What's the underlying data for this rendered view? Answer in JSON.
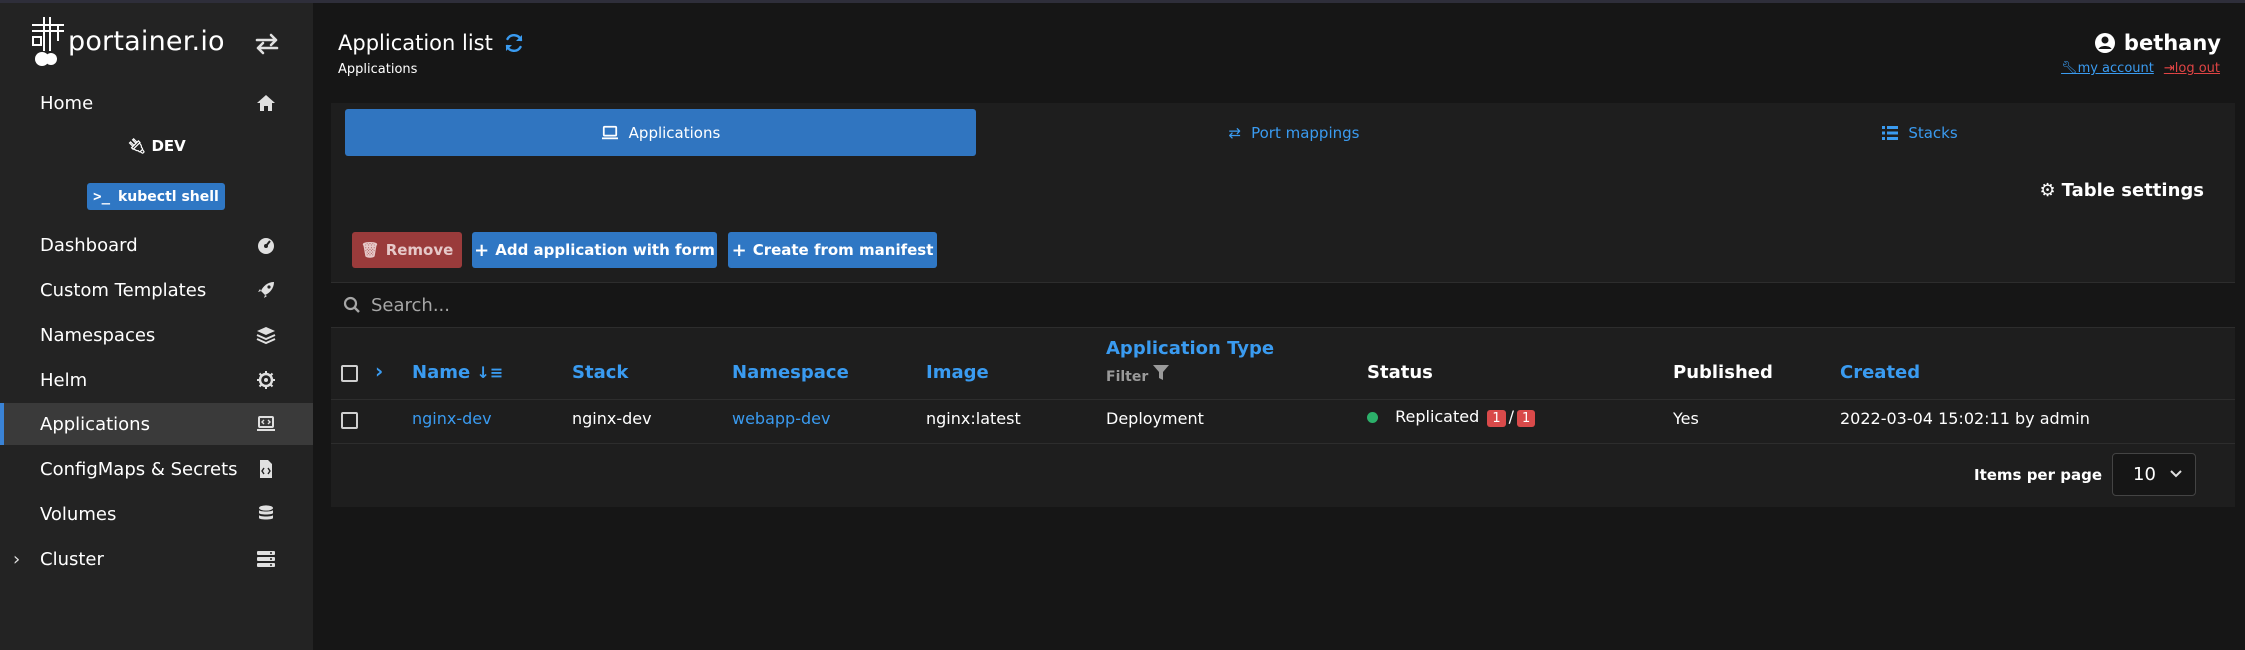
{
  "brand": {
    "logo_text": "portainer.io"
  },
  "sidebar": {
    "environment": "DEV",
    "kubectl_label": "kubectl shell",
    "items": [
      {
        "label": "Home",
        "icon": "home-icon"
      },
      {
        "label": "Dashboard",
        "icon": "gauge-icon"
      },
      {
        "label": "Custom Templates",
        "icon": "rocket-icon"
      },
      {
        "label": "Namespaces",
        "icon": "layers-icon"
      },
      {
        "label": "Helm",
        "icon": "helm-icon"
      },
      {
        "label": "Applications",
        "icon": "laptop-code-icon",
        "active": true
      },
      {
        "label": "ConfigMaps & Secrets",
        "icon": "file-code-icon"
      },
      {
        "label": "Volumes",
        "icon": "database-icon"
      },
      {
        "label": "Cluster",
        "icon": "server-icon"
      }
    ]
  },
  "header": {
    "title": "Application list",
    "subtitle": "Applications",
    "username": "bethany",
    "my_account": "my account",
    "log_out": "log out"
  },
  "tabs": [
    {
      "label": "Applications",
      "active": true
    },
    {
      "label": "Port mappings",
      "active": false
    },
    {
      "label": "Stacks",
      "active": false
    }
  ],
  "toolbar": {
    "table_settings": "Table settings",
    "remove": "Remove",
    "add_with_form": "Add application with form",
    "create_from_manifest": "Create from manifest"
  },
  "search": {
    "placeholder": "Search..."
  },
  "table": {
    "columns": {
      "name": "Name",
      "stack": "Stack",
      "namespace": "Namespace",
      "image": "Image",
      "app_type": "Application Type",
      "filter": "Filter",
      "status": "Status",
      "published": "Published",
      "created": "Created"
    },
    "rows": [
      {
        "name": "nginx-dev",
        "stack": "nginx-dev",
        "namespace": "webapp-dev",
        "image": "nginx:latest",
        "app_type": "Deployment",
        "status": "Replicated",
        "replicas_running": "1",
        "replicas_sep": "/",
        "replicas_total": "1",
        "published": "Yes",
        "created": "2022-03-04 15:02:11 by admin"
      }
    ]
  },
  "pagination": {
    "label": "Items per page",
    "value": "10"
  },
  "colors": {
    "accent": "#3a9bf0",
    "primary_button": "#2f77c4",
    "danger": "#d94a4a",
    "status_ok": "#2cb06a"
  }
}
